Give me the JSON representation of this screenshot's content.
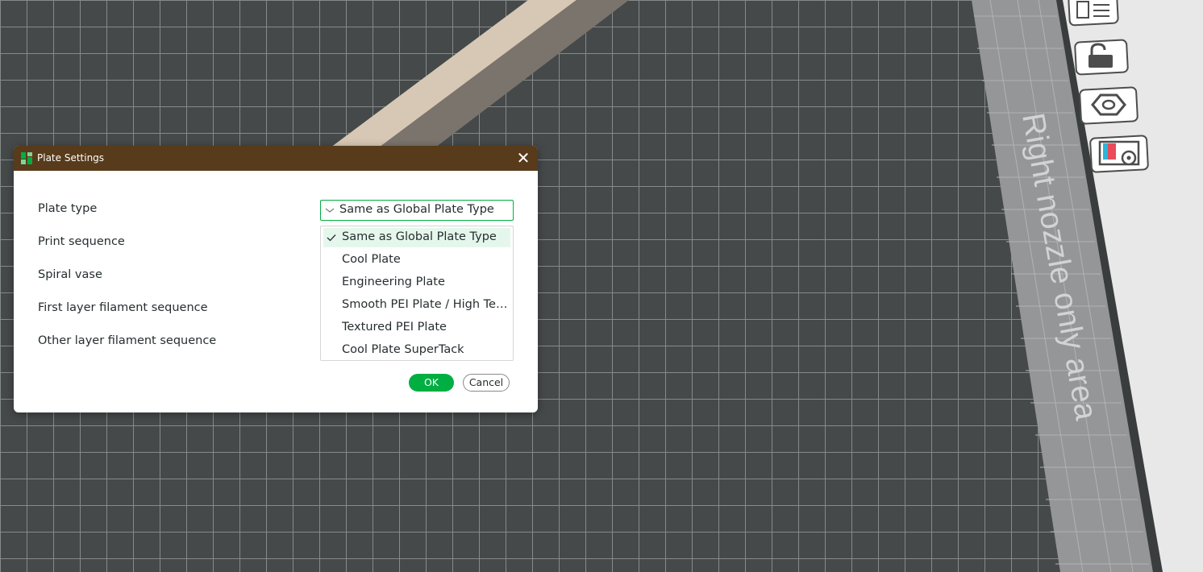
{
  "viewport": {
    "watermark": "Right nozzle only area",
    "toolbar_icons": [
      "plate-layout-icon",
      "lock-icon",
      "hex-nut-icon",
      "plate-settings-icon"
    ]
  },
  "dialog": {
    "title": "Plate Settings",
    "close_glyph": "✕",
    "rows": [
      "Plate type",
      "Print sequence",
      "Spiral vase",
      "First layer filament sequence",
      "Other layer filament sequence"
    ],
    "plate_type": {
      "value": "Same as Global Plate Type",
      "options": [
        {
          "label": "Same as Global Plate Type",
          "selected": true
        },
        {
          "label": "Cool Plate",
          "selected": false
        },
        {
          "label": "Engineering Plate",
          "selected": false
        },
        {
          "label": "Smooth PEI Plate / High Temp Plate",
          "selected": false
        },
        {
          "label": "Textured PEI Plate",
          "selected": false
        },
        {
          "label": "Cool Plate SuperTack",
          "selected": false
        }
      ]
    },
    "ok_label": "OK",
    "cancel_label": "Cancel"
  },
  "colors": {
    "bed": "#45494a",
    "grid_line": "#8c9090",
    "title_bar": "#573b1a",
    "accent": "#00ae42",
    "selected_item_bg": "#e5f7ec"
  }
}
